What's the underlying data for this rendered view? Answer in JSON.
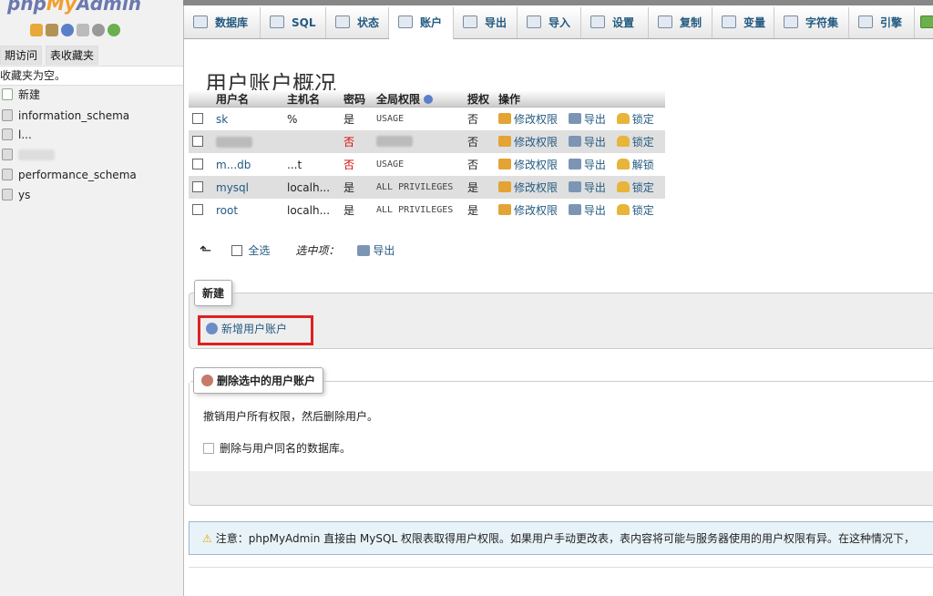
{
  "nav": {
    "logo_php": "php",
    "logo_my": "My",
    "logo_admin": "Admin",
    "tabs": [
      "期访问",
      "表收藏夹"
    ],
    "favorites_empty": "收藏夹为空。",
    "databases": [
      {
        "label": "新建"
      },
      {
        "label": "information_schema"
      },
      {
        "label": "l..."
      },
      {
        "label": ""
      },
      {
        "label": "performance_schema"
      },
      {
        "label": "ys"
      }
    ]
  },
  "topmenu": {
    "tabs": [
      {
        "label": "数据库",
        "icon": "database-icon"
      },
      {
        "label": "SQL",
        "icon": "sql-icon"
      },
      {
        "label": "状态",
        "icon": "status-icon"
      },
      {
        "label": "账户",
        "icon": "users-icon",
        "active": true
      },
      {
        "label": "导出",
        "icon": "export-icon"
      },
      {
        "label": "导入",
        "icon": "import-icon"
      },
      {
        "label": "设置",
        "icon": "wrench-icon"
      },
      {
        "label": "复制",
        "icon": "replication-icon"
      },
      {
        "label": "变量",
        "icon": "variables-icon"
      },
      {
        "label": "字符集",
        "icon": "charset-icon"
      },
      {
        "label": "引擎",
        "icon": "engine-icon"
      }
    ]
  },
  "page": {
    "title": "用户账户概况"
  },
  "users_table": {
    "headers": [
      "用户名",
      "主机名",
      "密码",
      "全局权限",
      "授权",
      "操作"
    ],
    "rows": [
      {
        "user": "sk",
        "host": "%",
        "password": "是",
        "privileges": "USAGE",
        "grant": "否",
        "lock": "锁定"
      },
      {
        "user": "",
        "host": "",
        "password": "否",
        "privileges": "",
        "grant": "否",
        "lock": "锁定"
      },
      {
        "user": "m...db",
        "host": "...t",
        "password": "否",
        "privileges": "USAGE",
        "grant": "否",
        "lock": "解锁"
      },
      {
        "user": "mysql",
        "host": "localh...",
        "password": "是",
        "privileges": "ALL PRIVILEGES",
        "grant": "是",
        "lock": "锁定"
      },
      {
        "user": "root",
        "host": "localh...",
        "password": "是",
        "privileges": "ALL PRIVILEGES",
        "grant": "是",
        "lock": "锁定"
      }
    ],
    "actions": {
      "edit": "修改权限",
      "export": "导出"
    }
  },
  "selection": {
    "select_all": "全选",
    "with_selected": "选中项：",
    "export": "导出"
  },
  "new_section": {
    "legend": "新建",
    "add_user": "新增用户账户"
  },
  "delete_section": {
    "legend": "删除选中的用户账户",
    "revoke_text": "撤销用户所有权限，然后删除用户。",
    "drop_db_label": "删除与用户同名的数据库。"
  },
  "notice": {
    "text": "注意：phpMyAdmin 直接由 MySQL 权限表取得用户权限。如果用户手动更改表，表内容将可能与服务器使用的用户权限有异。在这种情况下，"
  },
  "colors": {
    "link": "#235a81",
    "highlight": "#e02020",
    "no_password": "#dd0000"
  }
}
